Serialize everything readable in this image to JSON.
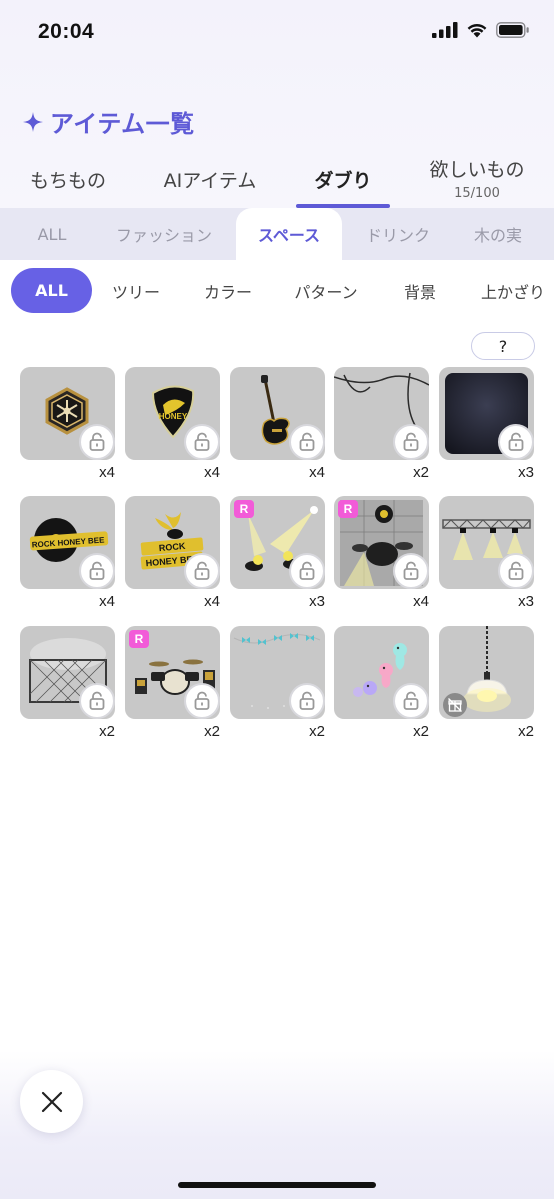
{
  "status": {
    "time": "20:04"
  },
  "header": {
    "title": "アイテム一覧"
  },
  "main_tabs": [
    {
      "label": "もちもの"
    },
    {
      "label": "AIアイテム"
    },
    {
      "label": "ダブり"
    },
    {
      "label": "欲しいもの",
      "count": "15/100"
    }
  ],
  "category_tabs": [
    {
      "label": "ALL"
    },
    {
      "label": "ファッション"
    },
    {
      "label": "スペース"
    },
    {
      "label": "ドリンク"
    },
    {
      "label": "木の実"
    }
  ],
  "filter_chips": [
    {
      "label": "ALL"
    },
    {
      "label": "ツリー"
    },
    {
      "label": "カラー"
    },
    {
      "label": "パターン"
    },
    {
      "label": "背景"
    },
    {
      "label": "上かざり"
    }
  ],
  "help_label": "?",
  "colors": {
    "accent": "#5e5ad6",
    "chip_active": "#6761e5",
    "rare_badge": "#f25bd8",
    "tile_bg": "#c8c8c8"
  },
  "items": [
    {
      "icon": "hexagon-emblem-icon",
      "count": "x4",
      "rare": false,
      "locked": true
    },
    {
      "icon": "guitar-pick-icon",
      "count": "x4",
      "rare": false,
      "locked": true
    },
    {
      "icon": "electric-guitar-icon",
      "count": "x4",
      "rare": false,
      "locked": true
    },
    {
      "icon": "hanging-cables-icon",
      "count": "x2",
      "rare": false,
      "locked": true
    },
    {
      "icon": "dark-panel-icon",
      "count": "x3",
      "rare": false,
      "locked": true
    },
    {
      "icon": "rock-record-sign-icon",
      "count": "x4",
      "rare": false,
      "locked": true
    },
    {
      "icon": "honey-bee-logo-icon",
      "count": "x4",
      "rare": false,
      "locked": true
    },
    {
      "icon": "spotlights-icon",
      "count": "x3",
      "rare": true,
      "rare_label": "R",
      "locked": true
    },
    {
      "icon": "drum-stage-icon",
      "count": "x4",
      "rare": true,
      "rare_label": "R",
      "locked": true
    },
    {
      "icon": "stage-truss-lights-icon",
      "count": "x3",
      "rare": false,
      "locked": true
    },
    {
      "icon": "fence-backdrop-icon",
      "count": "x2",
      "rare": false,
      "locked": true
    },
    {
      "icon": "drum-kit-icon",
      "count": "x2",
      "rare": true,
      "rare_label": "R",
      "locked": true
    },
    {
      "icon": "bow-garland-icon",
      "count": "x2",
      "rare": false,
      "locked": true
    },
    {
      "icon": "ghost-friends-icon",
      "count": "x2",
      "rare": false,
      "locked": true
    },
    {
      "icon": "pendant-lamp-icon",
      "count": "x2",
      "rare": false,
      "locked": false,
      "gift": true
    }
  ]
}
